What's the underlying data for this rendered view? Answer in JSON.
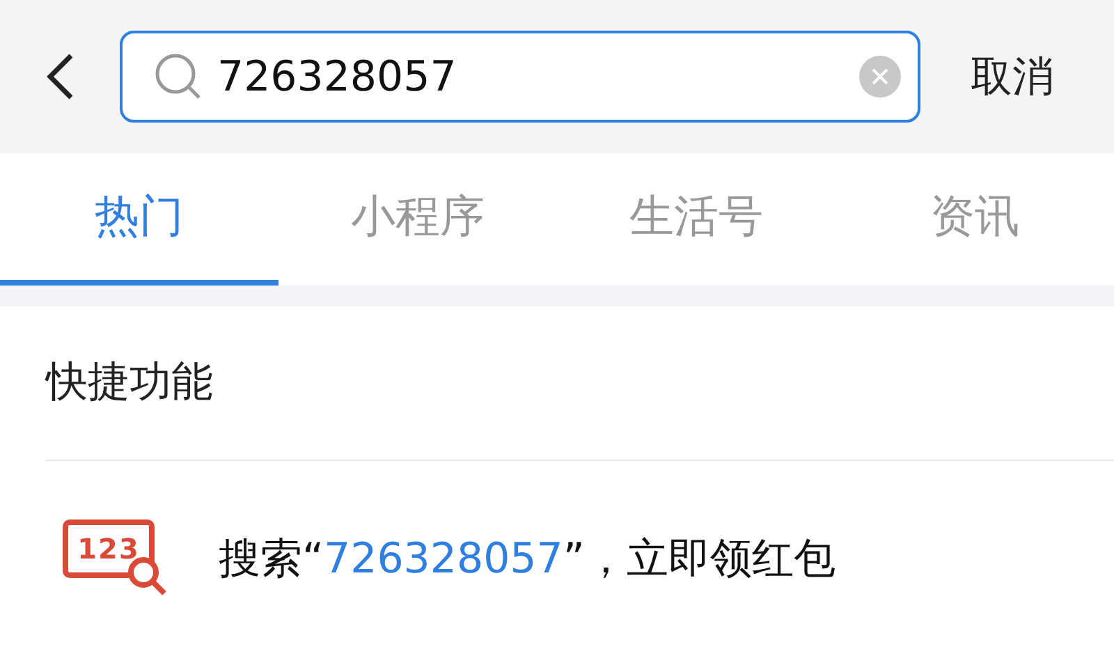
{
  "search_bar": {
    "value": "726328057",
    "cancel": "取消"
  },
  "tabs": [
    {
      "label": "热门",
      "selected": true
    },
    {
      "label": "小程序",
      "selected": false
    },
    {
      "label": "生活号",
      "selected": false
    },
    {
      "label": "资讯",
      "selected": false
    }
  ],
  "section": {
    "title": "快捷功能",
    "items": [
      {
        "icon_text": "123",
        "prefix": "搜索“",
        "keyword": "726328057",
        "suffix": "”，立即领红包"
      }
    ]
  }
}
